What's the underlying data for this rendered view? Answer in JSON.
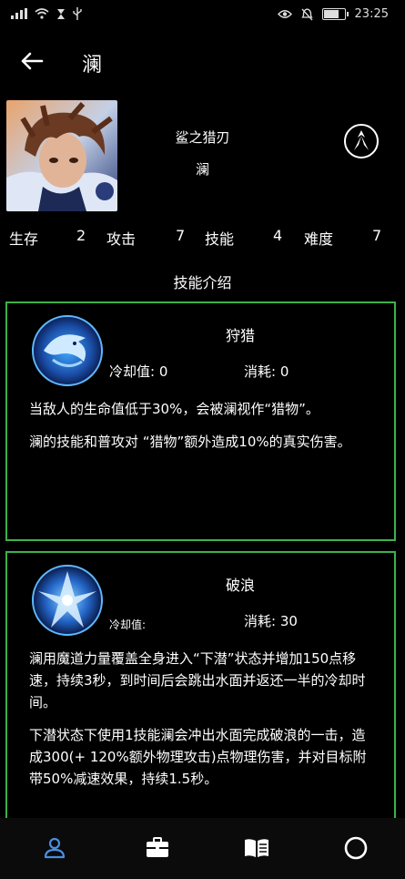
{
  "status_bar": {
    "time": "23:25",
    "icons": [
      "signal-icon",
      "wifi-icon",
      "hourglass-icon",
      "usb-icon",
      "eye-icon",
      "mute-icon",
      "battery-icon"
    ]
  },
  "header": {
    "title": "澜",
    "back_icon": "back-arrow-icon"
  },
  "hero": {
    "skin_name": "鲨之猎刃",
    "name": "澜",
    "role_icon": "assassin-role-icon"
  },
  "stats": [
    {
      "label": "生存",
      "value": "2"
    },
    {
      "label": "攻击",
      "value": "7"
    },
    {
      "label": "技能",
      "value": "4"
    },
    {
      "label": "难度",
      "value": "7"
    }
  ],
  "section_title": "技能介绍",
  "skills": [
    {
      "name": "狩猎",
      "cooldown_label": "冷却值: 0",
      "cost_label": "消耗: 0",
      "desc": [
        "当敌人的生命值低于30%，会被澜视作“猎物”。",
        "澜的技能和普攻对 “猎物”额外造成10%的真实伤害。"
      ]
    },
    {
      "name": "破浪",
      "cooldown_label": "冷却值:",
      "cost_label": "消耗: 30",
      "desc": [
        "澜用魔道力量覆盖全身进入“下潜”状态并增加150点移速，持续3秒，到时间后会跳出水面并返还一半的冷却时间。",
        "下潜状态下使用1技能澜会冲出水面完成破浪的一击，造成300(+ 120%额外物理攻击)点物理伤害，并对目标附带50%减速效果，持续1.5秒。"
      ]
    }
  ],
  "bottom_nav": [
    {
      "icon": "person-icon",
      "active": true
    },
    {
      "icon": "briefcase-icon",
      "active": false
    },
    {
      "icon": "book-icon",
      "active": false
    },
    {
      "icon": "circle-icon",
      "active": false
    }
  ],
  "colors": {
    "accent": "#3cb24a",
    "active_nav": "#4a8fe0",
    "background": "#000000"
  }
}
